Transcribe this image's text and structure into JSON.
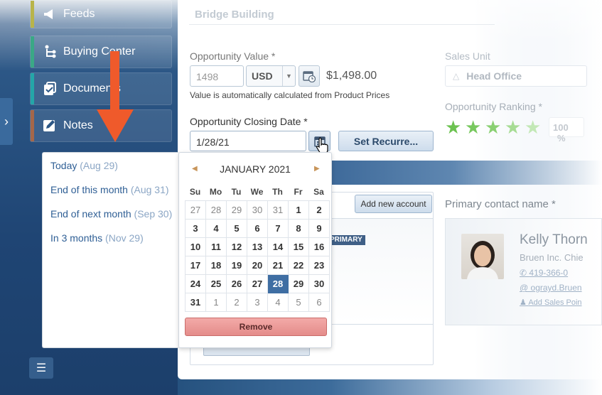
{
  "sidebar": {
    "items": [
      {
        "label": "Feeds",
        "icon": "megaphone-icon",
        "stripe": "#b8b44a"
      },
      {
        "label": "Buying Center",
        "icon": "org-chart-icon",
        "stripe": "#3aa886"
      },
      {
        "label": "Documents",
        "icon": "document-icon",
        "stripe": "#24a6a8"
      },
      {
        "label": "Notes",
        "icon": "notes-icon",
        "stripe": "#a5674a"
      }
    ]
  },
  "main": {
    "section_title": "Bridge Building",
    "opportunity_value": {
      "label": "Opportunity Value *",
      "amount": "1498",
      "currency": "USD",
      "formatted": "$1,498.00",
      "hint": "Value is automatically calculated from Product Prices"
    },
    "sales_unit": {
      "label": "Sales Unit",
      "value": "Head Office"
    },
    "closing_date": {
      "label": "Opportunity Closing Date *",
      "value": "1/28/21",
      "recurrence_button": "Set Recurre..."
    },
    "ranking": {
      "label": "Opportunity Ranking *",
      "stars": 5,
      "value": "100",
      "unit": "%"
    },
    "account": {
      "add_button": "Add new account",
      "badge": "PRIMARY"
    },
    "primary_contact": {
      "label": "Primary contact name *",
      "name": "Kelly Thorn",
      "company": "Bruen Inc. Chie",
      "phone": "419-366-0",
      "email": "ograyd.Bruen",
      "add_link": "Add Sales Poin"
    }
  },
  "presets": [
    {
      "label": "Today",
      "date": "(Aug 29)"
    },
    {
      "label": "End of this month",
      "date": "(Aug 31)"
    },
    {
      "label": "End of next month",
      "date": "(Sep 30)"
    },
    {
      "label": "In 3 months",
      "date": "(Nov 29)"
    }
  ],
  "calendar": {
    "month_label": "JANUARY 2021",
    "weekdays": [
      "Su",
      "Mo",
      "Tu",
      "We",
      "Th",
      "Fr",
      "Sa"
    ],
    "weeks": [
      [
        "27",
        "28",
        "29",
        "30",
        "31",
        "1",
        "2"
      ],
      [
        "3",
        "4",
        "5",
        "6",
        "7",
        "8",
        "9"
      ],
      [
        "10",
        "11",
        "12",
        "13",
        "14",
        "15",
        "16"
      ],
      [
        "17",
        "18",
        "19",
        "20",
        "21",
        "22",
        "23"
      ],
      [
        "24",
        "25",
        "26",
        "27",
        "28",
        "29",
        "30"
      ],
      [
        "31",
        "1",
        "2",
        "3",
        "4",
        "5",
        "6"
      ]
    ],
    "selected_day": "28",
    "remove_label": "Remove"
  }
}
